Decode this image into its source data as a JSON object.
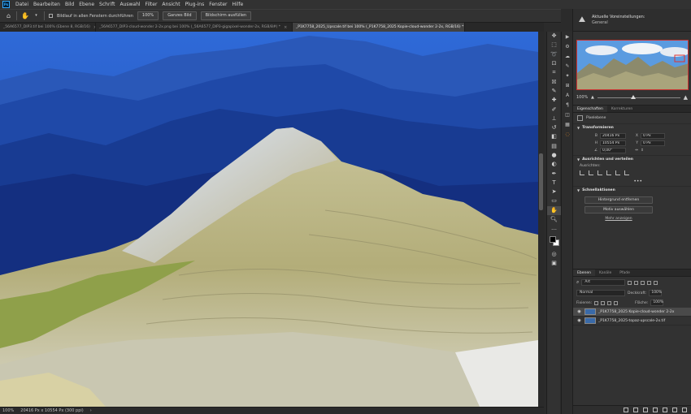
{
  "app": {
    "logo": "Ps"
  },
  "menu": [
    "Datei",
    "Bearbeiten",
    "Bild",
    "Ebene",
    "Schrift",
    "Auswahl",
    "Filter",
    "Ansicht",
    "Plug-ins",
    "Fenster",
    "Hilfe"
  ],
  "options": {
    "scroll_all_label": "Bildlauf in allen Fenstern durchführen",
    "zoom_100_label": "100%",
    "fit_label": "Ganzes Bild",
    "fill_label": "Bildschirm ausfüllen"
  },
  "tabs": [
    {
      "label": "_56A6577_DIP3.tif bei 100% (Ebene 8, RGB/16)",
      "active": false
    },
    {
      "label": "_56A6577_DIP3-cloud-wonder 2-2x.png bei 100% (_56A6577_DIP3-gigapixel-wonder-2x, RGB/8#) *",
      "active": false
    },
    {
      "label": "_P1K7758_2025_Upscale.tif bei 100% (_P1K7758_2025 Kopie-cloud-wonder 2-2x, RGB/16) *",
      "active": true
    }
  ],
  "status": {
    "zoom": "100%",
    "dimensions": "20416 Px x 10554 Px (300 ppi)"
  },
  "navigator": {
    "title": "Aktuelle Voreinstellungen:",
    "subtitle": "General",
    "zoom": "100%"
  },
  "properties": {
    "tabs": [
      "Eigenschaften",
      "Korrekturen"
    ],
    "kind": "Pixelebene",
    "transform_title": "Transformieren",
    "w_label": "B",
    "w_value": "20416 Px",
    "x_label": "X",
    "x_value": "0 Px",
    "h_label": "H",
    "h_value": "10554 Px",
    "y_label": "Y",
    "y_value": "0 Px",
    "angle_value": "0,00°",
    "align_title": "Ausrichten und verteilen",
    "align_label": "Ausrichten:",
    "quick_title": "Schnellaktionen",
    "remove_bg": "Hintergrund entfernen",
    "select_subject": "Motiv auswählen",
    "more": "Mehr anzeigen"
  },
  "layers": {
    "tabs": [
      "Ebenen",
      "Kanäle",
      "Pfade"
    ],
    "filter_label": "Art",
    "blend_mode": "Normal",
    "opacity_label": "Deckkraft:",
    "opacity": "100%",
    "lock_label": "Fixieren:",
    "fill_label": "Fläche:",
    "fill": "100%",
    "items": [
      {
        "name": "_P1K7758_2025 Kopie-cloud-wonder 2-2x",
        "selected": true
      },
      {
        "name": "_P1K7758_2025-topaz-upscale-2x.tif",
        "selected": false
      }
    ]
  },
  "tools": [
    "move-icon",
    "marquee-icon",
    "lasso-icon",
    "object-select-icon",
    "crop-icon",
    "frame-icon",
    "eyedropper-icon",
    "spot-heal-icon",
    "brush-icon",
    "stamp-icon",
    "history-brush-icon",
    "eraser-icon",
    "gradient-icon",
    "blur-icon",
    "dodge-icon",
    "pen-icon",
    "type-icon",
    "path-select-icon",
    "rectangle-icon",
    "hand-icon",
    "zoom-icon",
    "more-icon"
  ]
}
